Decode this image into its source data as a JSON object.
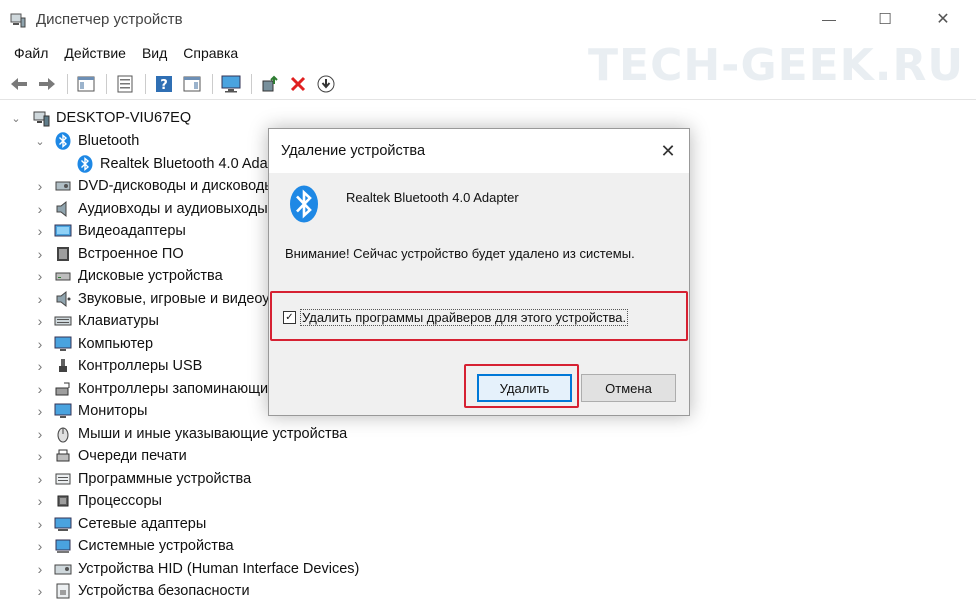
{
  "window": {
    "title": "Диспетчер устройств",
    "controls": {
      "minimize": "—",
      "maximize": "☐",
      "close": "✕"
    }
  },
  "watermark": "TECH-GEEK.RU",
  "menu": [
    "Файл",
    "Действие",
    "Вид",
    "Справка"
  ],
  "toolbar": {
    "buttons": [
      "back-arrow-icon",
      "forward-arrow-icon",
      "show-hide-console-tree-icon",
      "properties-icon",
      "help-icon",
      "action-pane-icon",
      "monitor-icon",
      "update-driver-icon",
      "uninstall-device-icon",
      "disable-device-icon"
    ]
  },
  "tree": {
    "root": "DESKTOP-VIU67EQ",
    "bluetooth": {
      "label": "Bluetooth",
      "child": "Realtek Bluetooth 4.0 Adapter"
    },
    "categories": [
      "DVD-дисководы и дисководы компакт-дисков",
      "Аудиовходы и аудиовыходы",
      "Видеоадаптеры",
      "Встроенное ПО",
      "Дисковые устройства",
      "Звуковые, игровые и видеоустройства",
      "Клавиатуры",
      "Компьютер",
      "Контроллеры USB",
      "Контроллеры запоминающих устройств",
      "Мониторы",
      "Мыши и иные указывающие устройства",
      "Очереди печати",
      "Программные устройства",
      "Процессоры",
      "Сетевые адаптеры",
      "Системные устройства",
      "Устройства HID (Human Interface Devices)",
      "Устройства безопасности"
    ]
  },
  "dialog": {
    "title": "Удаление устройства",
    "close": "✕",
    "device_name": "Realtek Bluetooth 4.0 Adapter",
    "warning": "Внимание! Сейчас устройство будет удалено из системы.",
    "checkbox_label": "Удалить программы драйверов для этого устройства.",
    "checkbox_checked": true,
    "delete_button": "Удалить",
    "cancel_button": "Отмена"
  },
  "colors": {
    "highlight": "#d62132",
    "primary_button_border": "#0078d7",
    "bluetooth_blue": "#1e88e5"
  }
}
